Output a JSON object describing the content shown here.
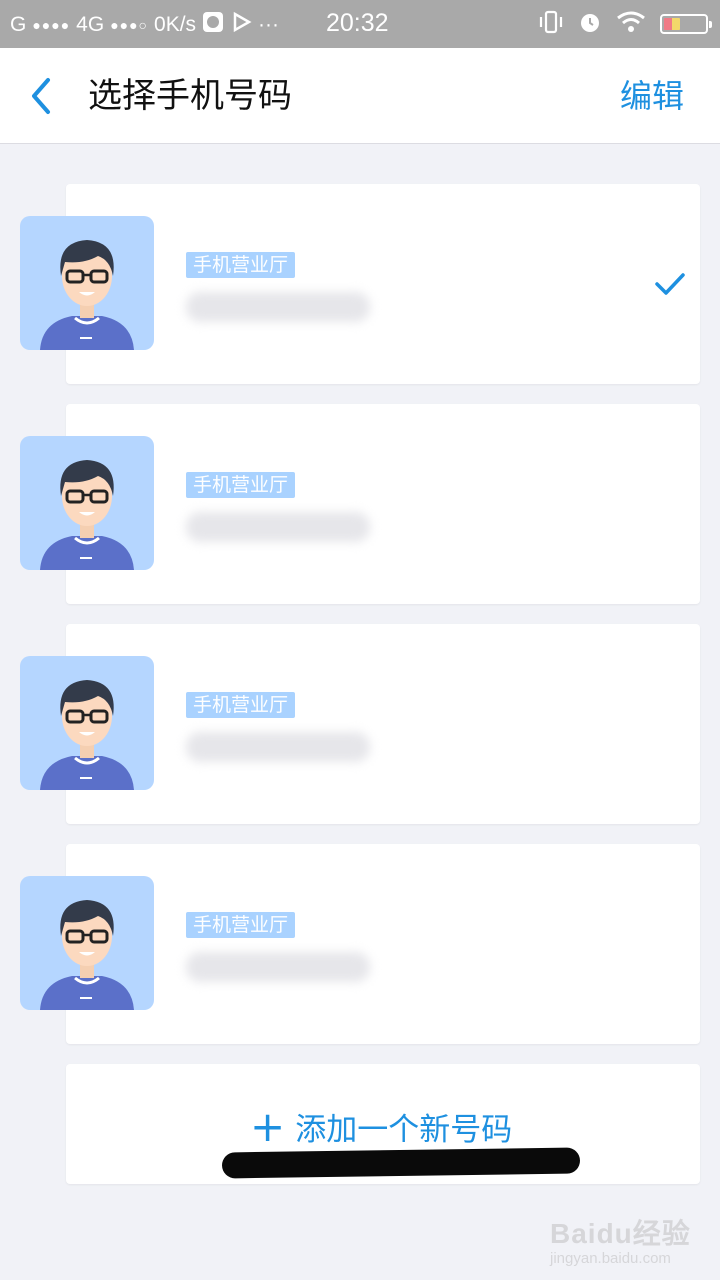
{
  "status_bar": {
    "carrier": "G",
    "network": "4G",
    "speed": "0K/s",
    "more": "···",
    "time": "20:32",
    "battery_level": 0.4
  },
  "header": {
    "title": "选择手机号码",
    "edit_label": "编辑"
  },
  "accounts": [
    {
      "tag": "手机营业厅",
      "selected": true
    },
    {
      "tag": "手机营业厅",
      "selected": false
    },
    {
      "tag": "手机营业厅",
      "selected": false
    },
    {
      "tag": "手机营业厅",
      "selected": false
    }
  ],
  "add_number": {
    "plus": "+",
    "label": "添加一个新号码"
  },
  "watermark": {
    "main": "Baidu经验",
    "sub": "jingyan.baidu.com"
  },
  "colors": {
    "accent": "#1e90e0",
    "tag_bg": "#a9d2ff",
    "avatar_bg": "#b5d6ff",
    "status_bar": "#a9a9a9"
  }
}
